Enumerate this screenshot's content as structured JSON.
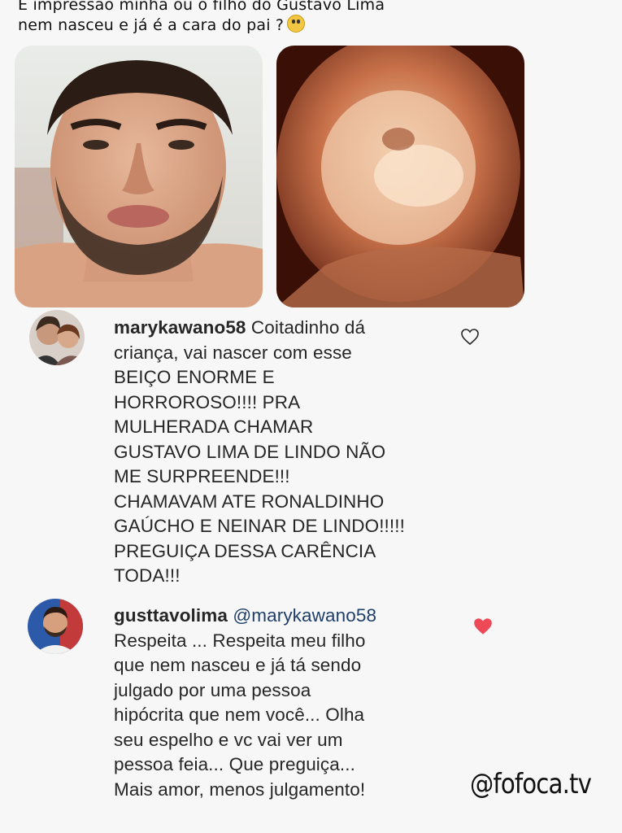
{
  "post": {
    "caption_line1": "É impressão minha ou o filho do Gustavo Lima",
    "caption_line2": "nem nasceu e já é a cara do pai ?",
    "caption_emoji": "screaming-face-emoji"
  },
  "images": [
    {
      "name": "man-selfie-photo"
    },
    {
      "name": "ultrasound-3d-photo"
    }
  ],
  "comments": [
    {
      "username": "marykawano58",
      "text_lines": [
        "Coitadinho dá",
        "criança, vai nascer com esse",
        "BEIÇO ENORME E",
        "HORROROSO!!!! PRA",
        "MULHERADA CHAMAR",
        "GUSTAVO LIMA DE LINDO NÃO",
        "ME SURPREENDE!!!",
        "CHAMAVAM ATE RONALDINHO",
        "GAÚCHO E NEINAR DE LINDO!!!!!",
        "PREGUIÇA DESSA CARÊNCIA",
        "TODA!!!"
      ],
      "liked": false,
      "heart_icon": "heart-outline-icon"
    },
    {
      "username": "gusttavolima",
      "mention": "@marykawano58",
      "text_lines": [
        "Respeita ... Respeita meu filho",
        "que nem nasceu e já tá sendo",
        "julgado por uma pessoa",
        "hipócrita que nem você... Olha",
        "seu espelho e vc vai ver um",
        "pessoa feia... Que preguiça...",
        "Mais amor, menos julgamento!"
      ],
      "liked": true,
      "heart_icon": "heart-filled-icon",
      "heart_color": "#ed4956"
    }
  ],
  "watermark": "@fofoca.tv"
}
